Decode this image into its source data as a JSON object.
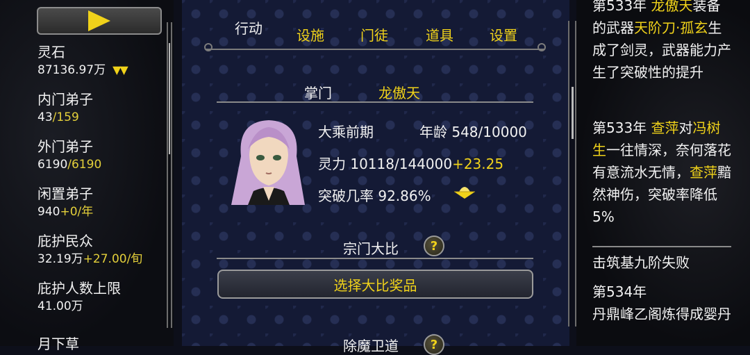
{
  "left": {
    "stats": [
      {
        "label": "灵石",
        "value": "87136.97万",
        "extra": "",
        "chevron": "▼▼"
      },
      {
        "label": "内门弟子",
        "value": "43",
        "extra": "/159"
      },
      {
        "label": "外门弟子",
        "value": "6190",
        "extra": "/6190"
      },
      {
        "label": "闲置弟子",
        "value": "940",
        "extra": "+0/年"
      },
      {
        "label": "庇护民众",
        "value": "32.19万",
        "extra": "+27.00/旬"
      },
      {
        "label": "庇护人数上限",
        "value": "",
        "extra": "41.00万"
      },
      {
        "label": "月下草",
        "value": "",
        "extra": ""
      }
    ]
  },
  "tabs": [
    {
      "label": "行动",
      "active": true
    },
    {
      "label": "设施"
    },
    {
      "label": "门徒"
    },
    {
      "label": "道具"
    },
    {
      "label": "设置"
    }
  ],
  "leader": {
    "title_label": "掌门",
    "name": "龙傲天",
    "realm": "大乘前期",
    "age_label": "年龄",
    "age": "548/10000",
    "power_label": "灵力",
    "power": "10118/144000",
    "power_rate": "+23.25",
    "breakthrough_label": "突破几率",
    "breakthrough": "92.86%"
  },
  "tournament": {
    "label": "宗门大比",
    "help": "?",
    "reward_button": "选择大比奖品"
  },
  "next_section": {
    "label": "除魔卫道",
    "help": "?"
  },
  "log": {
    "entry1": {
      "prefix": "第533年 ",
      "name1": "龙傲天",
      "t1": "装备的武器",
      "item": "天阶刀·孤玄",
      "t2": "生成了剑灵，武器能力产生了突破性的提升"
    },
    "entry2": {
      "prefix": "第533年 ",
      "name1": "查萍",
      "t1": "对",
      "name2": "冯树生",
      "t2": "一往情深，奈何落花有意流水无情，",
      "name3": "查萍",
      "t3": "黯然神伤，突破率降低5%"
    },
    "entry3": "击筑基九阶失败",
    "entry4": {
      "prefix": "第534年",
      "t1": "丹鼎峰乙阁炼得成婴丹"
    }
  },
  "colors": {
    "accent": "#f0d21a",
    "panel": "#141a35"
  }
}
